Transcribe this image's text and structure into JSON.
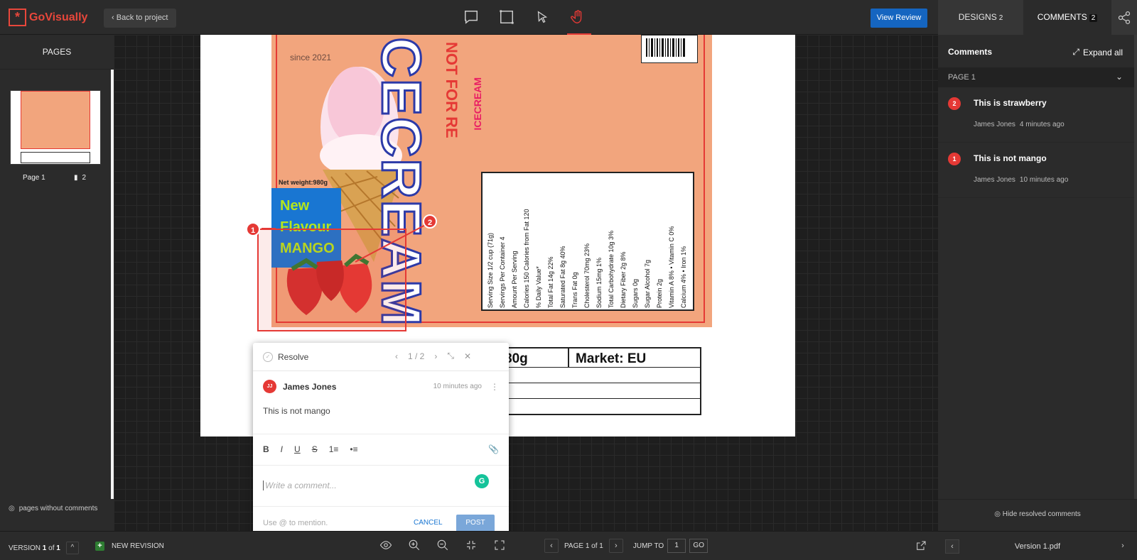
{
  "app": {
    "brand": "GoVisually",
    "logo_glyph": "*",
    "accent_color": "#e8473b"
  },
  "header": {
    "back_label": "Back to project",
    "tools": [
      "comment-icon",
      "rectangle-icon",
      "pointer-icon",
      "hand-icon"
    ],
    "view_review_label": "View Review",
    "designs_tab": {
      "label": "DESIGNS",
      "count": "2"
    },
    "comments_tab": {
      "label": "COMMENTS",
      "count": "2"
    }
  },
  "left_panel": {
    "title": "PAGES",
    "thumbnail": {
      "label": "Page 1",
      "comment_count": "2"
    },
    "pages_without_label": "pages without comments"
  },
  "canvas": {
    "artwork": {
      "since": "since 2021",
      "big_word": "ICECREAM",
      "not_for_resale": "NOT FOR RE",
      "small_word": "ICECREAM",
      "net_weight": "Net weight:980g",
      "new_flavour": [
        "New",
        "Flavour",
        "MANGO"
      ],
      "nutrition_lines": [
        "Serving Size 1/2 cup (71g)",
        "Servings Per Container 4",
        "Amount Per Serving",
        "Calories 150   Calories from Fat 120",
        "% Daily Value*",
        "Total Fat 14g   22%",
        "Saturated Fat 8g   40%",
        "Trans Fat 0g",
        "Cholesterol 70mg   23%",
        "Sodium 15mg   1%",
        "Total Carbohydrate 10g   3%",
        "Dietary Fiber 2g   8%",
        "Sugars 0g",
        "Sugar Alcohol 7g",
        "Protein 2g",
        "Vitamin A 8%   •   Vitamin C 0%",
        "Calcium 4%   •   Iron 1%"
      ],
      "table": {
        "weight": "80g",
        "market": "Market: EU"
      }
    },
    "pins": [
      "1",
      "2"
    ]
  },
  "popover": {
    "resolve_label": "Resolve",
    "nav": "1 / 2",
    "author_initials": "JJ",
    "author": "James Jones",
    "time": "10 minutes ago",
    "text": "This is not mango",
    "formatting": [
      "B",
      "I",
      "U",
      "S",
      "1≡",
      "•≡"
    ],
    "placeholder": "Write a comment...",
    "mention_hint": "Use @ to mention.",
    "cancel_label": "CANCEL",
    "post_label": "POST"
  },
  "right_panel": {
    "title": "Comments",
    "expand_label": "Expand all",
    "section": "PAGE 1",
    "comments": [
      {
        "num": "2",
        "title": "This is strawberry",
        "author": "James Jones",
        "time": "4 minutes ago"
      },
      {
        "num": "1",
        "title": "This is not mango",
        "author": "James Jones",
        "time": "10 minutes ago"
      }
    ],
    "hide_resolved_label": "Hide resolved comments"
  },
  "bottom": {
    "version_label": "VERSION",
    "version_current": "1",
    "version_of": "of",
    "version_total": "1",
    "new_revision_label": "NEW REVISION",
    "page_label": "PAGE 1 of 1",
    "jump_label": "JUMP TO",
    "jump_value": "1",
    "go_label": "GO",
    "file_name": "Version 1.pdf"
  }
}
